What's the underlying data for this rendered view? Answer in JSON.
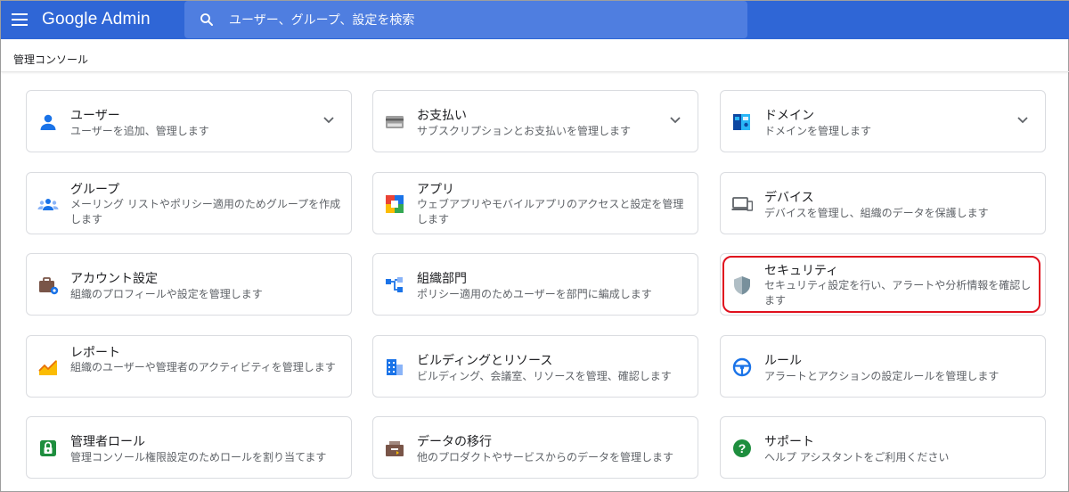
{
  "app": {
    "title": "Google Admin",
    "search_placeholder": "ユーザー、グループ、設定を検索"
  },
  "breadcrumb": "管理コンソール",
  "cards": {
    "users": {
      "title": "ユーザー",
      "desc": "ユーザーを追加、管理します"
    },
    "billing": {
      "title": "お支払い",
      "desc": "サブスクリプションとお支払いを管理します"
    },
    "domains": {
      "title": "ドメイン",
      "desc": "ドメインを管理します"
    },
    "groups": {
      "title": "グループ",
      "desc": "メーリング リストやポリシー適用のためグループを作成します"
    },
    "apps": {
      "title": "アプリ",
      "desc": "ウェブアプリやモバイルアプリのアクセスと設定を管理します"
    },
    "devices": {
      "title": "デバイス",
      "desc": "デバイスを管理し、組織のデータを保護します"
    },
    "account": {
      "title": "アカウント設定",
      "desc": "組織のプロフィールや設定を管理します"
    },
    "ou": {
      "title": "組織部門",
      "desc": "ポリシー適用のためユーザーを部門に編成します"
    },
    "security": {
      "title": "セキュリティ",
      "desc": "セキュリティ設定を行い、アラートや分析情報を確認します"
    },
    "reports": {
      "title": "レポート",
      "desc": "組織のユーザーや管理者のアクティビティを管理します"
    },
    "buildings": {
      "title": "ビルディングとリソース",
      "desc": "ビルディング、会議室、リソースを管理、確認します"
    },
    "rules": {
      "title": "ルール",
      "desc": "アラートとアクションの設定ルールを管理します"
    },
    "admin_roles": {
      "title": "管理者ロール",
      "desc": "管理コンソール権限設定のためロールを割り当てます"
    },
    "migration": {
      "title": "データの移行",
      "desc": "他のプロダクトやサービスからのデータを管理します"
    },
    "support": {
      "title": "サポート",
      "desc": "ヘルプ アシスタントをご利用ください"
    }
  },
  "colors": {
    "topbar": "#2f66d6",
    "search_bg": "#4f7ee0",
    "highlight": "#e0101e",
    "icon_blue": "#1a73e8",
    "icon_green": "#1e8e3e"
  },
  "icons": [
    "menu-icon",
    "search-icon",
    "person-icon",
    "credit-card-icon",
    "domain-icon",
    "group-icon",
    "apps-grid-icon",
    "devices-icon",
    "briefcase-gear-icon",
    "org-tree-icon",
    "shield-icon",
    "report-chart-icon",
    "building-icon",
    "steering-wheel-icon",
    "lock-icon",
    "migration-box-icon",
    "help-icon",
    "chevron-down-icon"
  ]
}
